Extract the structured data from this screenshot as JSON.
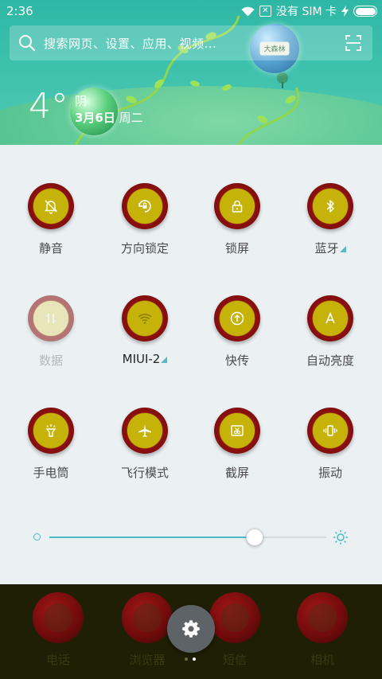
{
  "status_bar": {
    "time": "2:36",
    "carrier": "没有 SIM 卡",
    "sim_icon": "sim-x-icon",
    "wifi_icon": "wifi-icon",
    "charging_icon": "charging-bolt-icon",
    "battery_icon": "battery-full-icon"
  },
  "search": {
    "placeholder": "搜索网页、设置、应用、视频...",
    "search_icon": "search-icon",
    "scan_icon": "scan-icon"
  },
  "weather": {
    "temperature": "4°",
    "condition": "阴",
    "date": "3月6日",
    "weekday": "周二"
  },
  "wallpaper": {
    "orb_label": "大森林"
  },
  "toggles": [
    {
      "label": "静音",
      "icon": "bell-off-icon",
      "enabled": true
    },
    {
      "label": "方向锁定",
      "icon": "rotation-lock-icon",
      "enabled": true
    },
    {
      "label": "锁屏",
      "icon": "lock-icon",
      "enabled": true
    },
    {
      "label": "蓝牙",
      "icon": "bluetooth-icon",
      "enabled": true,
      "has_more": true
    },
    {
      "label": "数据",
      "icon": "mobile-data-icon",
      "enabled": false
    },
    {
      "label": "MIUI-2",
      "icon": "wifi-icon",
      "enabled": true,
      "has_more": true
    },
    {
      "label": "快传",
      "icon": "share-transfer-icon",
      "enabled": true
    },
    {
      "label": "自动亮度",
      "icon": "auto-brightness-icon",
      "enabled": true
    },
    {
      "label": "手电筒",
      "icon": "flashlight-icon",
      "enabled": true
    },
    {
      "label": "飞行模式",
      "icon": "airplane-icon",
      "enabled": true
    },
    {
      "label": "截屏",
      "icon": "screenshot-icon",
      "enabled": true
    },
    {
      "label": "振动",
      "icon": "vibrate-icon",
      "enabled": true
    }
  ],
  "brightness": {
    "level": 0.74,
    "accent": "#4cbac5"
  },
  "dock": {
    "apps": [
      {
        "label": "电话",
        "icon": "phone-icon"
      },
      {
        "label": "浏览器",
        "icon": "browser-icon"
      },
      {
        "label": "短信",
        "icon": "message-icon"
      },
      {
        "label": "相机",
        "icon": "camera-icon"
      }
    ],
    "settings_icon": "gear-icon",
    "pages": 2,
    "current_page": 2
  },
  "colors": {
    "toggle_fill": "#c6b30a",
    "toggle_ring": "#8c1010",
    "panel_bg": "#ebf1f3",
    "wallpaper": "#3cc1ad"
  }
}
